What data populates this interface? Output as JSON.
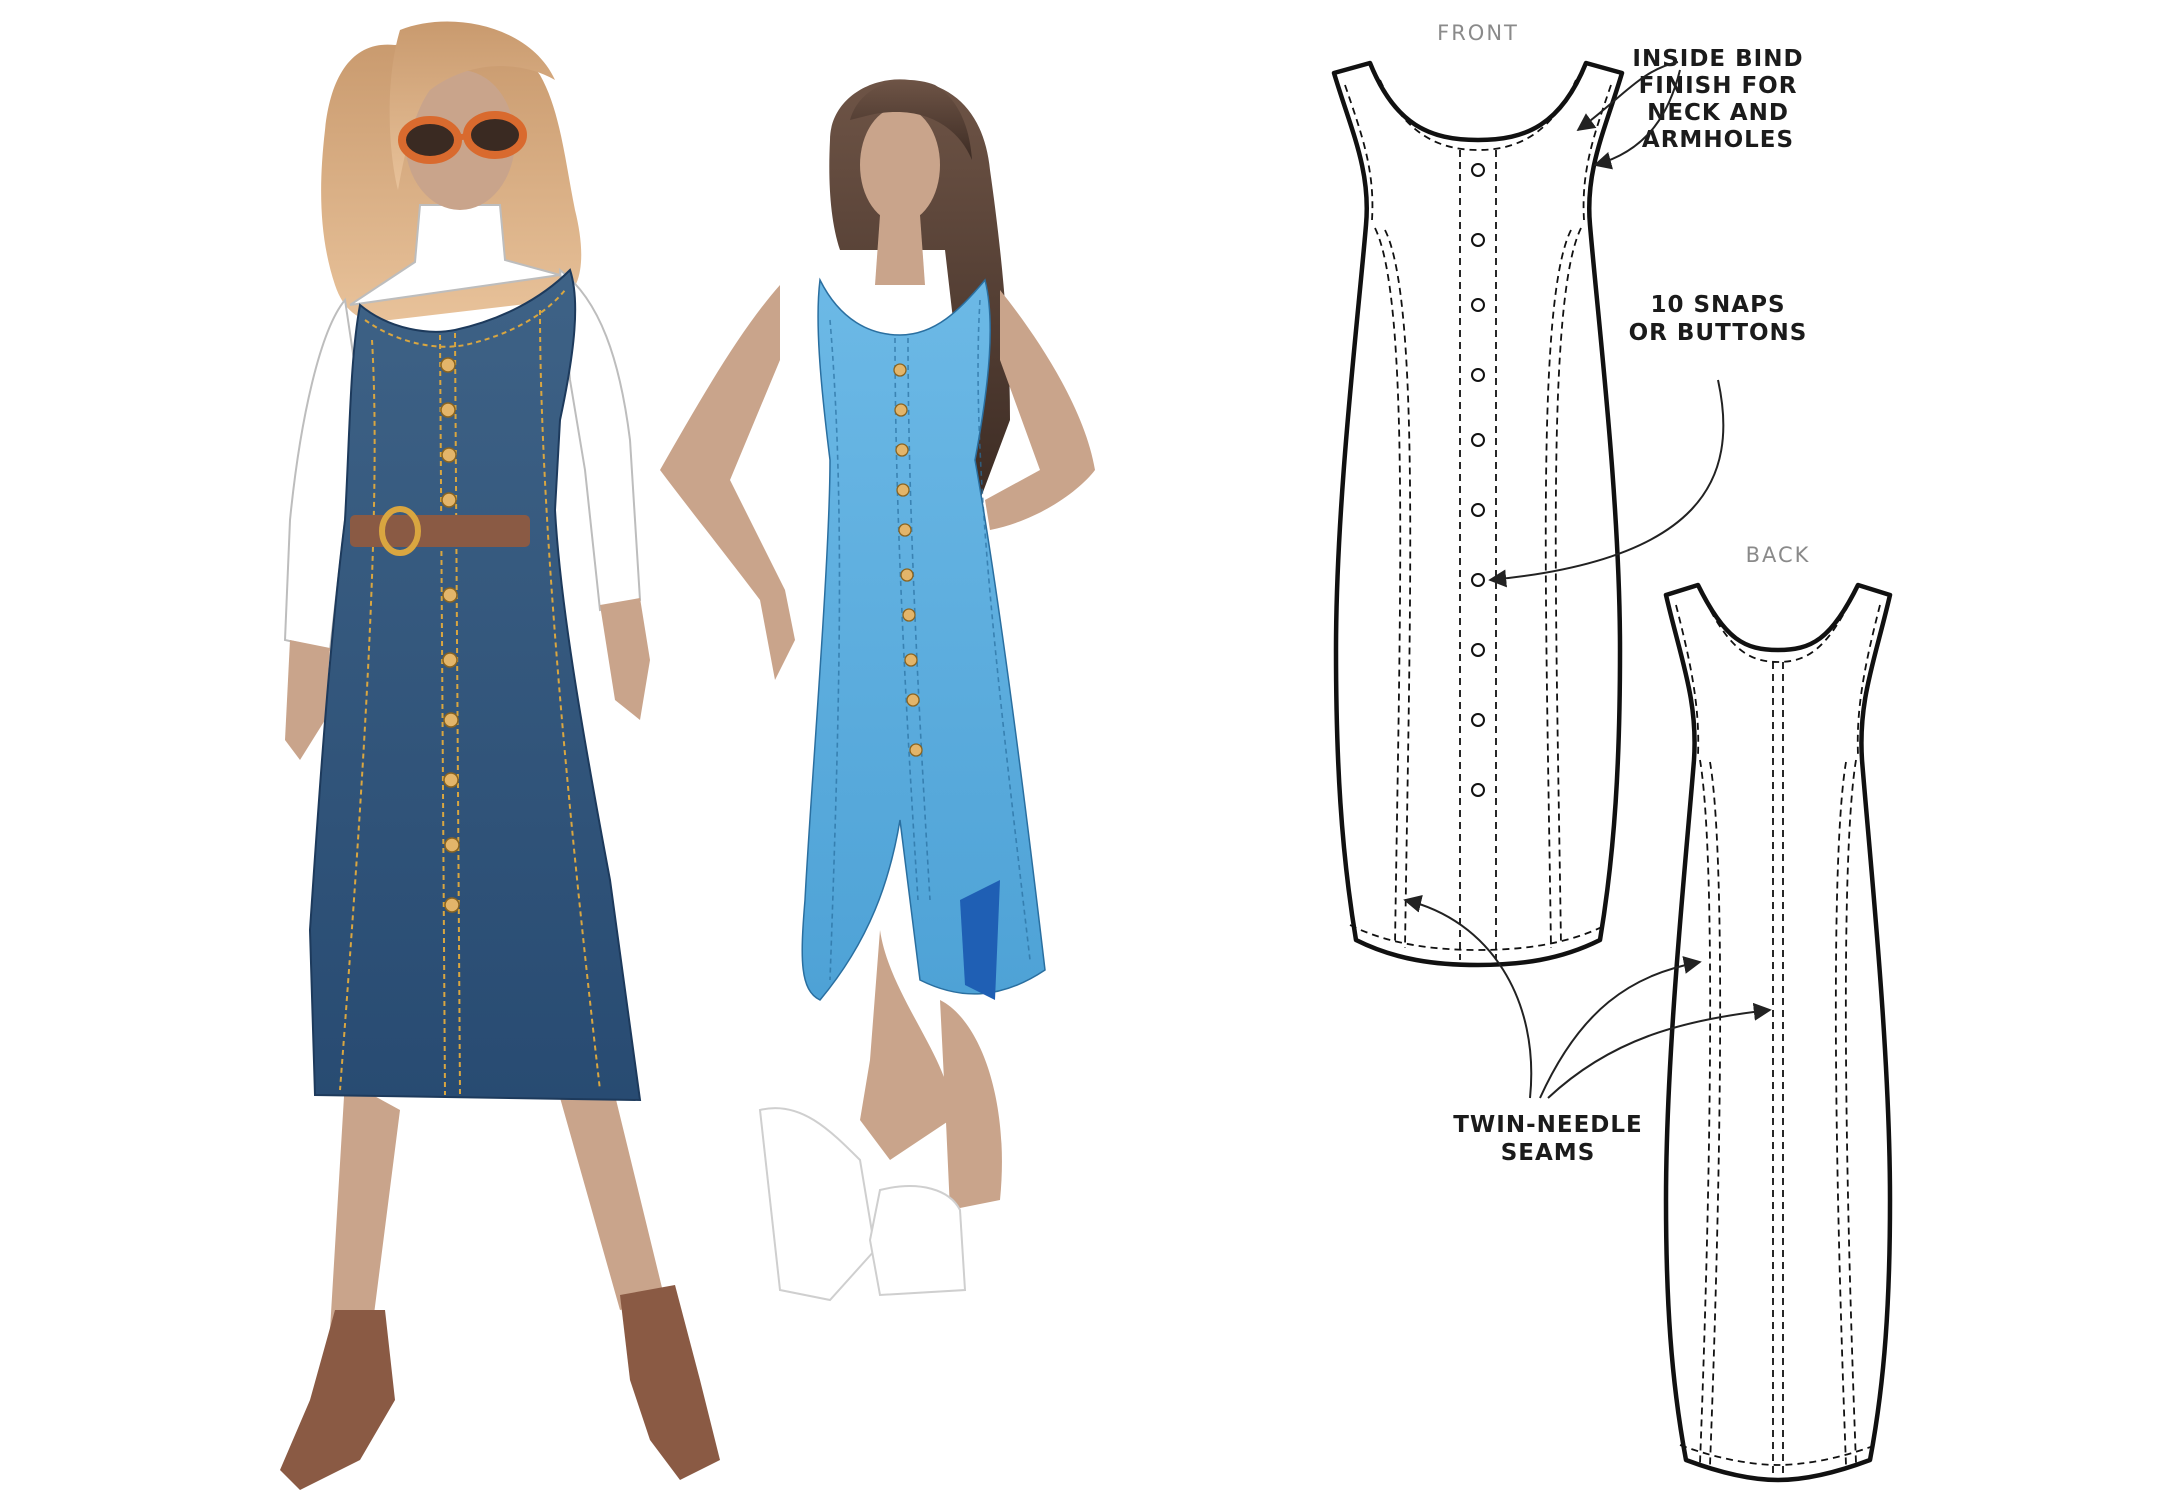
{
  "views": {
    "front": "FRONT",
    "back": "BACK"
  },
  "callouts": {
    "bind_line1": "INSIDE BIND",
    "bind_line2": "FINISH FOR",
    "bind_line3": "NECK AND",
    "bind_line4": "ARMHOLES",
    "snaps_line1": "10 SNAPS",
    "snaps_line2": "OR BUTTONS",
    "seams_line1": "TWIN-NEEDLE",
    "seams_line2": "SEAMS"
  },
  "colors": {
    "dark_denim": "#2f5279",
    "light_denim": "#5fb0e0",
    "skin": "#c9a48b",
    "stitch_gold": "#d9a640",
    "boot_brown": "#8a5a44"
  }
}
